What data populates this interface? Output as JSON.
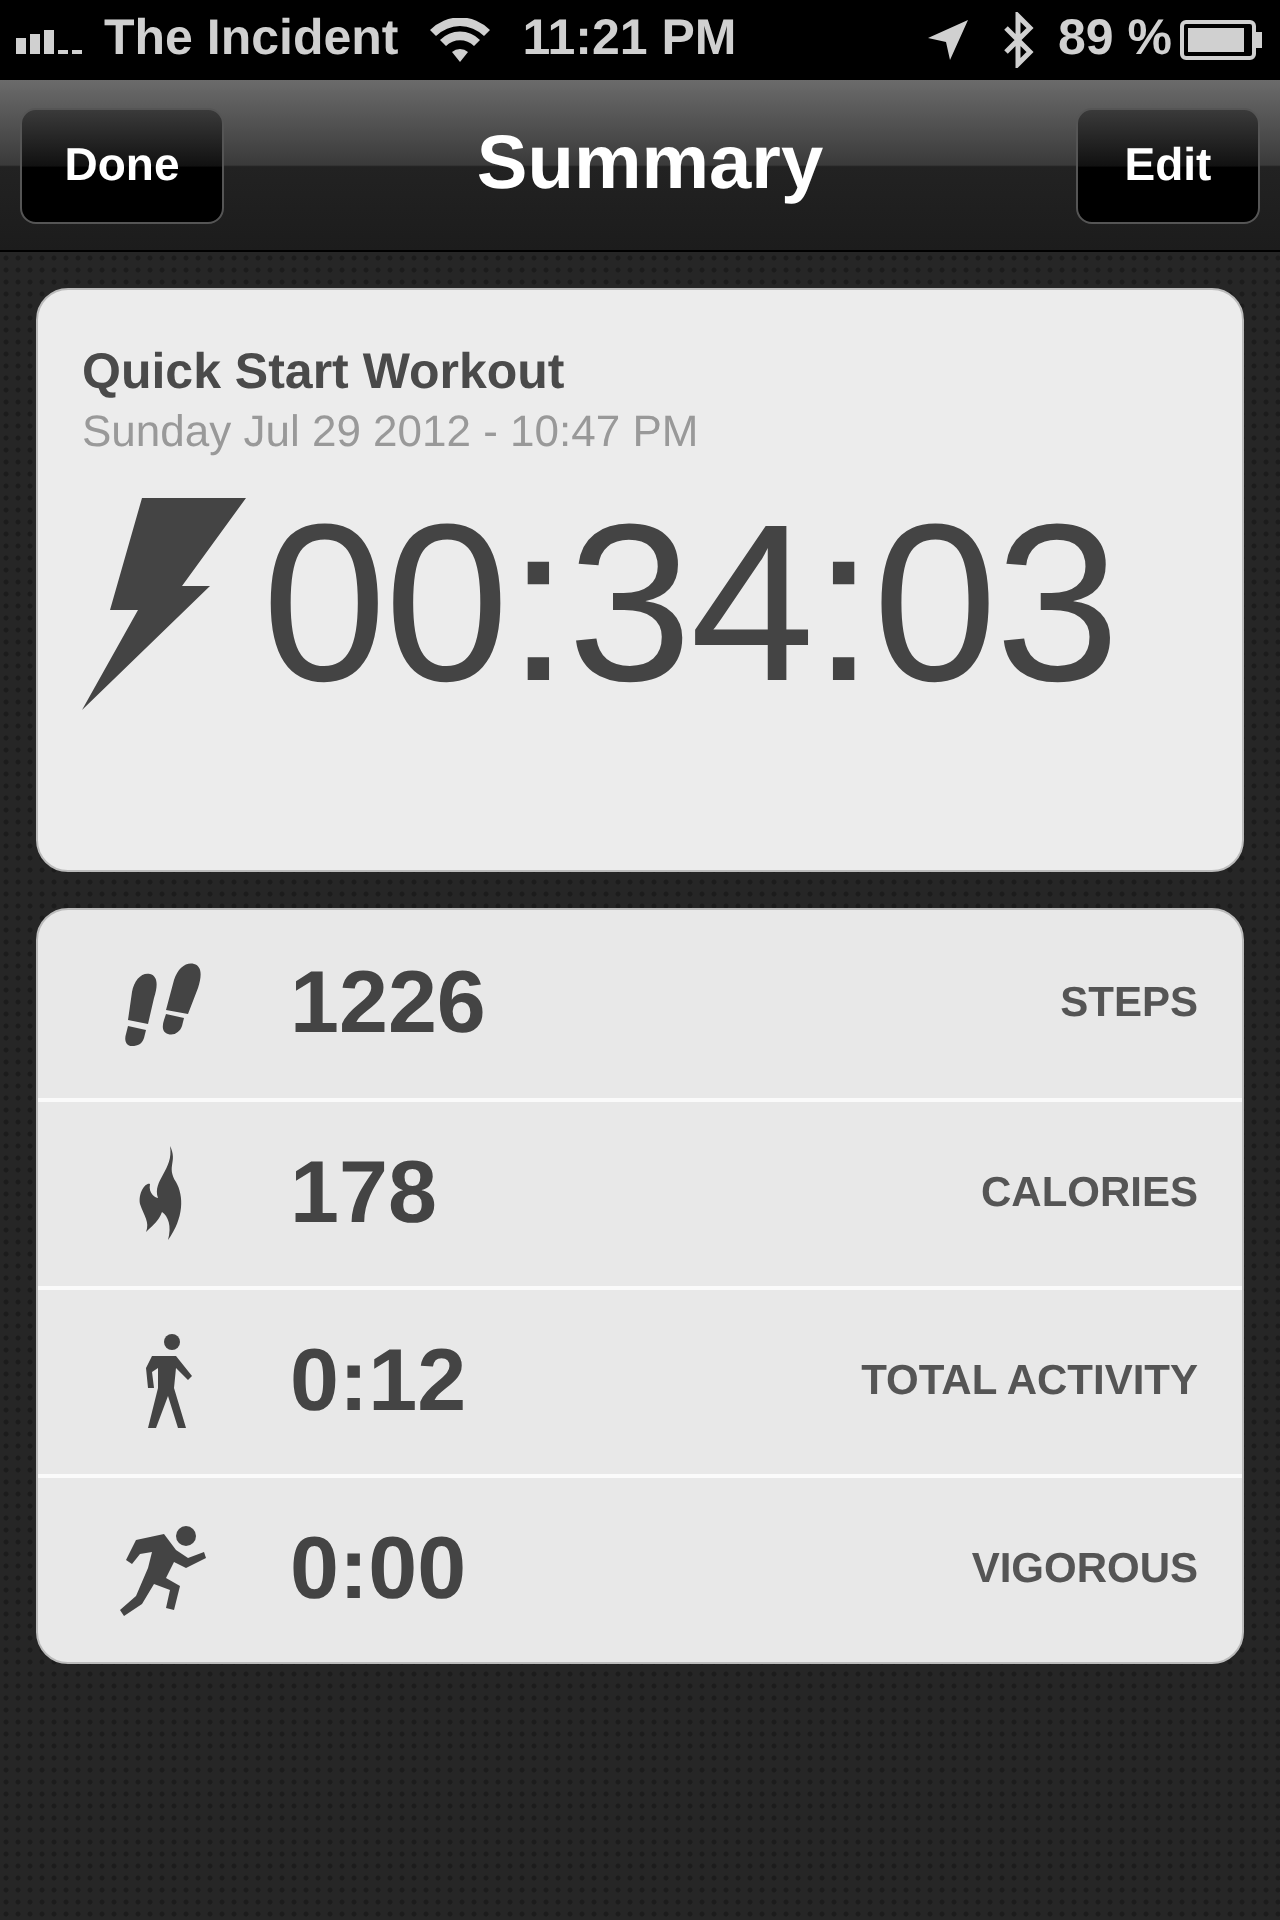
{
  "status_bar": {
    "carrier": "The Incident",
    "time": "11:21 PM",
    "battery": "89 %"
  },
  "nav_bar": {
    "left_button": "Done",
    "title": "Summary",
    "right_button": "Edit"
  },
  "workout": {
    "title": "Quick Start Workout",
    "date": "Sunday Jul 29 2012 - 10:47 PM",
    "duration": "00:34:03"
  },
  "stats": [
    {
      "kind": "steps",
      "value": "1226",
      "label": "STEPS"
    },
    {
      "kind": "calories",
      "value": "178",
      "label": "CALORIES"
    },
    {
      "kind": "walk",
      "value": "0:12",
      "label": "TOTAL ACTIVITY"
    },
    {
      "kind": "run",
      "value": "0:00",
      "label": "VIGOROUS"
    }
  ]
}
